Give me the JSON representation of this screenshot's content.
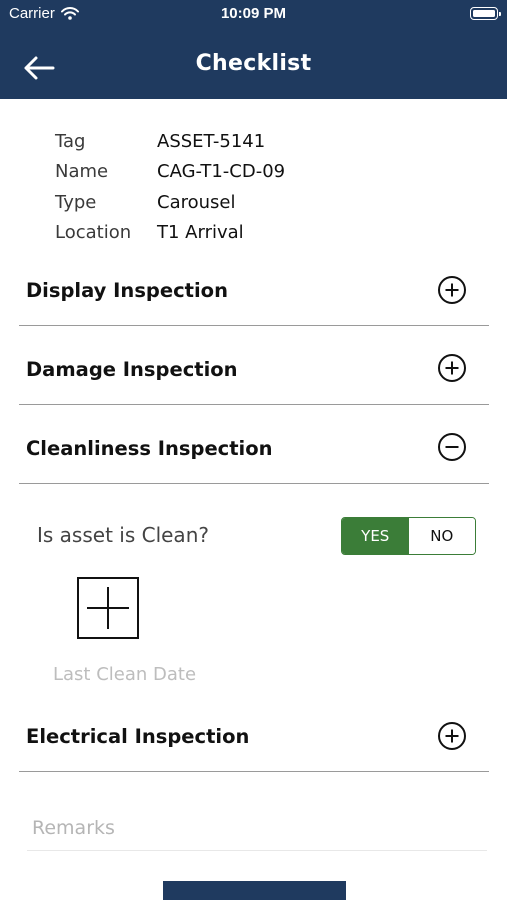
{
  "status_bar": {
    "carrier": "Carrier",
    "time": "10:09 PM"
  },
  "header": {
    "title": "Checklist",
    "back_icon": "arrow-left-icon"
  },
  "asset": [
    {
      "label": "Tag",
      "value": "ASSET-5141"
    },
    {
      "label": "Name",
      "value": "CAG-T1-CD-09"
    },
    {
      "label": "Type",
      "value": "Carousel"
    },
    {
      "label": "Location",
      "value": "T1 Arrival"
    }
  ],
  "sections": [
    {
      "title": "Display Inspection",
      "state": "collapsed",
      "icon": "plus-circle-icon"
    },
    {
      "title": "Damage Inspection",
      "state": "collapsed",
      "icon": "plus-circle-icon"
    },
    {
      "title": "Cleanliness Inspection",
      "state": "expanded",
      "icon": "minus-circle-icon"
    },
    {
      "title": "Electrical Inspection",
      "state": "collapsed",
      "icon": "plus-circle-icon"
    }
  ],
  "cleanliness": {
    "question": "Is asset is Clean?",
    "yes_label": "YES",
    "no_label": "NO",
    "selected": "YES",
    "last_clean_date_placeholder": "Last Clean Date"
  },
  "remarks": {
    "placeholder": "Remarks",
    "value": ""
  },
  "colors": {
    "header": "#1f3a5f",
    "toggle_active": "#3b7d38",
    "divider": "#9a9a9a",
    "placeholder": "#bdbdbd"
  }
}
